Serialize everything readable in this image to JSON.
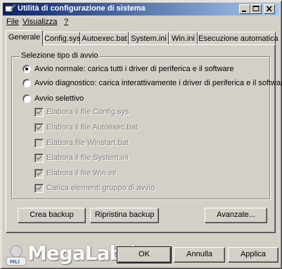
{
  "window": {
    "title": "Utilità di configurazione di sistema",
    "controls": {
      "minimize": "_",
      "maximize": "□",
      "close": "×"
    }
  },
  "menu": {
    "items": [
      {
        "label": "File"
      },
      {
        "label": "Visualizza"
      },
      {
        "label": "?"
      }
    ]
  },
  "tabs": [
    {
      "label": "Generale",
      "active": true
    },
    {
      "label": "Config.sys"
    },
    {
      "label": "Autoexec.bat"
    },
    {
      "label": "System.ini"
    },
    {
      "label": "Win.ini"
    },
    {
      "label": "Esecuzione automatica"
    }
  ],
  "startup": {
    "group_title": "Selezione tipo di avvio",
    "normal": "Avvio normale: carica tutti i driver di periferica e il software",
    "diagnostic": "Avvio diagnostico: carica interattivamente i driver di periferica e il software",
    "selective": "Avvio selettivo",
    "selected": "normal",
    "options": [
      {
        "label": "Elabora il file Config.sys",
        "checked": true
      },
      {
        "label": "Elabora il file Autoexec.bat",
        "checked": true
      },
      {
        "label": "Elabora file Winstart.bat",
        "checked": false
      },
      {
        "label": "Elabora il file System.ini",
        "checked": true
      },
      {
        "label": "Elabora il file Win.ini",
        "checked": true
      },
      {
        "label": "Carica elementi gruppo di avvio",
        "checked": true
      }
    ]
  },
  "buttons": {
    "backup": "Crea backup",
    "restore": "Ripristina backup",
    "advanced": "Avanzate...",
    "ok": "OK",
    "cancel": "Annulla",
    "apply": "Applica"
  },
  "watermark": {
    "text": "MegaLab.it"
  },
  "colors": {
    "title_start": "#0a246a",
    "title_end": "#a6caf0",
    "face": "#d4d0c8"
  }
}
